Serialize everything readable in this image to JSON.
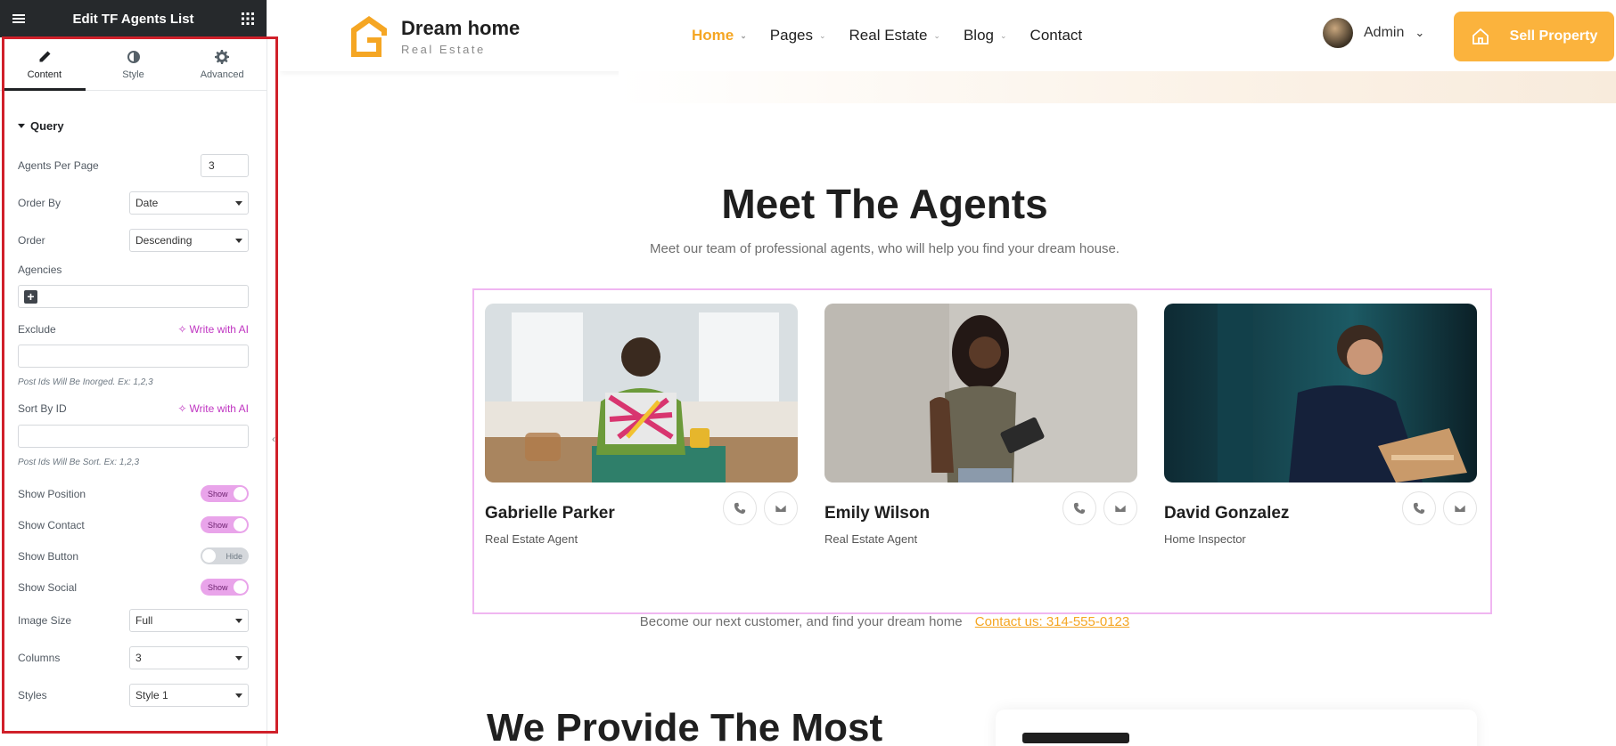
{
  "editor": {
    "title": "Edit TF Agents List",
    "tabs": [
      {
        "label": "Content",
        "icon": "pencil-icon",
        "active": true
      },
      {
        "label": "Style",
        "icon": "contrast-icon",
        "active": false
      },
      {
        "label": "Advanced",
        "icon": "gear-icon",
        "active": false
      }
    ],
    "section": "Query",
    "agents_per_page_label": "Agents Per Page",
    "agents_per_page_value": "3",
    "order_by_label": "Order By",
    "order_by_value": "Date",
    "order_label": "Order",
    "order_value": "Descending",
    "agencies_label": "Agencies",
    "exclude_label": "Exclude",
    "write_ai_label": "Write with AI",
    "exclude_help": "Post Ids Will Be Inorged. Ex: 1,2,3",
    "sort_by_id_label": "Sort By ID",
    "sort_help": "Post Ids Will Be Sort. Ex: 1,2,3",
    "show_position_label": "Show Position",
    "show_position_state": "Show",
    "show_contact_label": "Show Contact",
    "show_contact_state": "Show",
    "show_button_label": "Show Button",
    "show_button_state": "Hide",
    "show_social_label": "Show Social",
    "show_social_state": "Show",
    "image_size_label": "Image Size",
    "image_size_value": "Full",
    "columns_label": "Columns",
    "columns_value": "3",
    "styles_label": "Styles",
    "styles_value": "Style 1"
  },
  "site": {
    "brand_name": "Dream home",
    "brand_sub": "Real Estate",
    "nav": [
      "Home",
      "Pages",
      "Real Estate",
      "Blog",
      "Contact"
    ],
    "user": "Admin",
    "cta": "Sell Property",
    "accent": "#f5a623",
    "section_title": "Meet The Agents",
    "section_sub": "Meet our team of professional agents, who will help you find your dream house.",
    "agents": [
      {
        "name": "Gabrielle Parker",
        "role": "Real Estate Agent"
      },
      {
        "name": "Emily Wilson",
        "role": "Real Estate Agent"
      },
      {
        "name": "David Gonzalez",
        "role": "Home Inspector"
      }
    ],
    "footline_text": "Become our next customer, and find your dream home",
    "footline_link": "Contact us: 314-555-0123",
    "next_title": "We Provide The Most"
  }
}
